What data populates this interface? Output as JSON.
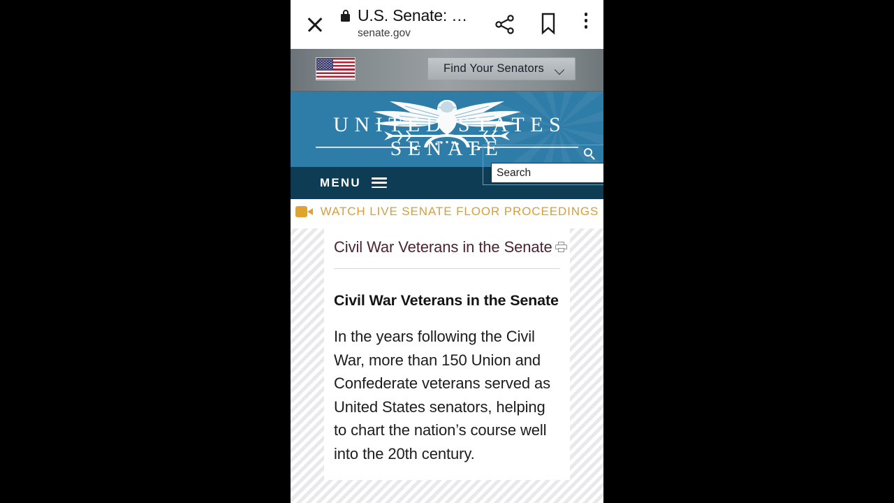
{
  "browser": {
    "close_label": "close",
    "title": "U.S. Senate: …",
    "host": "senate.gov",
    "share_label": "share",
    "bookmark_label": "bookmark",
    "more_label": "more options"
  },
  "topbar": {
    "flag_alt": "United States flag",
    "find_senators_label": "Find Your Senators"
  },
  "banner": {
    "wordmark": "UNITED STATES SENATE",
    "emblem_alt": "Senate eagle emblem"
  },
  "navbar": {
    "menu_label": "MENU"
  },
  "search": {
    "placeholder": "Search",
    "value": ""
  },
  "alert": {
    "text": "WATCH LIVE SENATE FLOOR PROCEEDINGS"
  },
  "article": {
    "title": "Civil War Veterans in the Senate",
    "section_heading": "Civil War Veterans in the Senate",
    "paragraph": "In the years following the Civil War, more than 150 Union and Confederate veterans served as United States senators, helping to chart the nation’s course well into the 20th century."
  },
  "colors": {
    "banner_blue": "#2e7ca8",
    "navbar_navy": "#0e3c55",
    "alert_gold": "#d4a03c",
    "title_maroon": "#4a2433",
    "topbar_gray": "#9aa0a3"
  }
}
